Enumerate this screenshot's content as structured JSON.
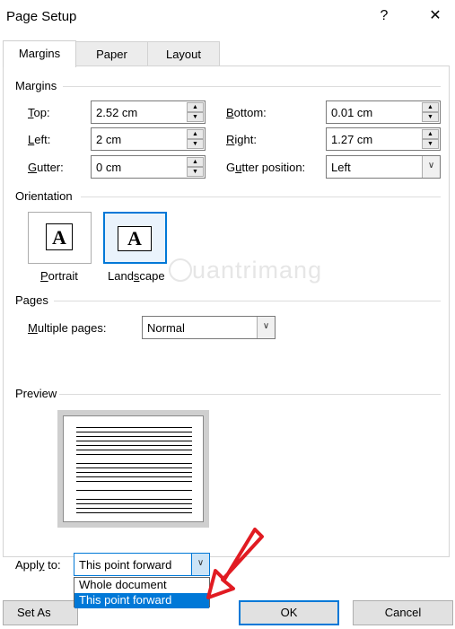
{
  "dialog": {
    "title": "Page Setup",
    "help_icon": "?",
    "close_icon": "✕"
  },
  "tabs": [
    {
      "label": "Margins",
      "active": true
    },
    {
      "label": "Paper",
      "active": false
    },
    {
      "label": "Layout",
      "active": false
    }
  ],
  "margins": {
    "group_label": "Margins",
    "top_label": "op:",
    "top_mnemonic": "T",
    "top_value": "2.52 cm",
    "left_label": "eft:",
    "left_mnemonic": "L",
    "left_value": "2 cm",
    "gutter_label": "utter:",
    "gutter_mnemonic": "G",
    "gutter_value": "0 cm",
    "bottom_label": "ottom:",
    "bottom_mnemonic": "B",
    "bottom_value": "0.01 cm",
    "right_label": "ight:",
    "right_mnemonic": "R",
    "right_value": "1.27 cm",
    "gutter_position_label_pre": "G",
    "gutter_position_label_mid": "u",
    "gutter_position_label_post": "tter position:",
    "gutter_position_value": "Left"
  },
  "orientation": {
    "group_label": "Orientation",
    "portrait_label_mn": "P",
    "portrait_label": "ortrait",
    "landscape_label_pre": "Land",
    "landscape_label_mn": "s",
    "landscape_label_post": "cape",
    "icon_letter": "A",
    "selected": "landscape"
  },
  "pages": {
    "group_label": "Pages",
    "multiple_pages_label_mn": "M",
    "multiple_pages_label": "ultiple pages:",
    "multiple_pages_value": "Normal"
  },
  "preview": {
    "group_label": "Preview"
  },
  "apply_to": {
    "label_pre": "Appl",
    "label_mn": "y",
    "label_post": " to:",
    "value": "This point forward",
    "options": [
      "Whole document",
      "This point forward"
    ],
    "highlighted_option": "This point forward"
  },
  "buttons": {
    "set_as_default": "Set As Defa",
    "ok": "OK",
    "cancel": "Cancel"
  },
  "watermark_text": "uantrimang",
  "colors": {
    "accent": "#0078d7",
    "arrow": "#e11b22"
  }
}
